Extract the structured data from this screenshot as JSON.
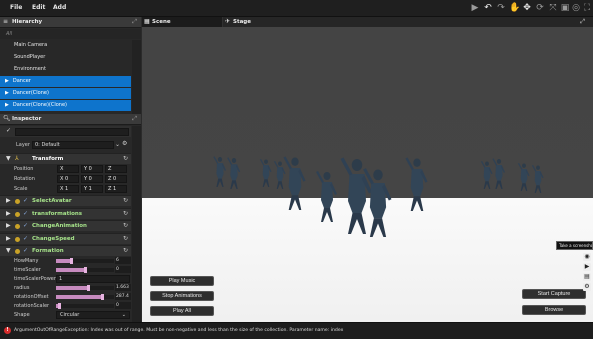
{
  "menubar": {
    "items": [
      "File",
      "Edit",
      "Add"
    ]
  },
  "toolbar": {
    "icons": [
      "play-icon",
      "undo-icon",
      "redo-icon",
      "hand-icon",
      "move-icon",
      "rotate-icon",
      "scale-icon",
      "rect-icon",
      "globe-icon",
      "fullscreen-icon"
    ]
  },
  "hierarchy": {
    "title": "Hierarchy",
    "search_placeholder": "All",
    "items": [
      {
        "label": "Main Camera",
        "selected": false
      },
      {
        "label": "SoundPlayer",
        "selected": false
      },
      {
        "label": "Environment",
        "selected": false
      },
      {
        "label": "Dancer",
        "selected": true
      },
      {
        "label": "Dancer(Clone)",
        "selected": true
      },
      {
        "label": "Dancer(Clone)(Clone)",
        "selected": true
      }
    ]
  },
  "inspector": {
    "title": "Inspector",
    "layer_label": "Layer",
    "layer_value": "0: Default",
    "transform": {
      "title": "Transform",
      "rows": [
        {
          "label": "Position",
          "x": "X",
          "y": "Y 0",
          "z": "Z"
        },
        {
          "label": "Rotation",
          "x": "X 0",
          "y": "Y 0",
          "z": "Z 0"
        },
        {
          "label": "Scale",
          "x": "X 1",
          "y": "Y 1",
          "z": "Z 1"
        }
      ]
    },
    "components": [
      "SelectAvatar",
      "transformations",
      "ChangeAnimation",
      "ChangeSpeed",
      "Formation"
    ],
    "formation_fields": [
      {
        "label": "HowMany",
        "value": "6",
        "fill": 0.25
      },
      {
        "label": "timeScaler",
        "value": "0",
        "fill": 0.5
      },
      {
        "label": "timeScalerPower",
        "value": "1",
        "fill": null
      },
      {
        "label": "radius",
        "value": "1.663",
        "fill": 0.55
      },
      {
        "label": "rotationOffset",
        "value": "287.4",
        "fill": 0.8
      },
      {
        "label": "rotationScaler",
        "value": "0",
        "fill": 0.05
      },
      {
        "label": "Shape",
        "value": "Circular",
        "fill": null
      }
    ]
  },
  "viewport": {
    "tabs": [
      "Scene",
      "Stage"
    ],
    "buttons": {
      "play_music": "Play Music",
      "stop_animations": "Stop Animations",
      "play_all": "Play All",
      "start_capture": "Start Capture",
      "browse": "Browse"
    },
    "tooltip": "Take a screenshot"
  },
  "status": {
    "message": "ArgumentOutOfRangeException: Index was out of range. Must be non-negative and less than the size of the collection. Parameter name: index"
  },
  "colors": {
    "selection": "#0e74cc",
    "component_name": "#a6e38a",
    "slider": "#c78bbf",
    "error": "#d52b2b"
  }
}
